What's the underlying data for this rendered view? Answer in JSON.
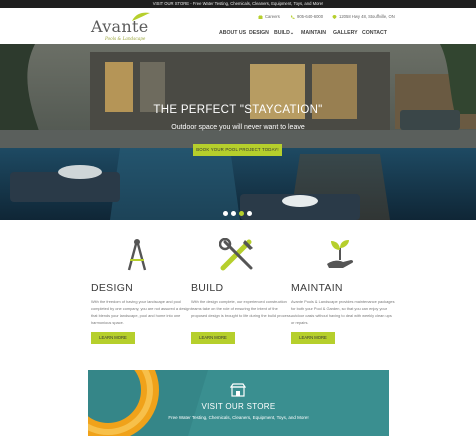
{
  "topbar": {
    "text": "VISIT OUR STORE - Free Water Testing, Chemicals, Cleaners, Equipment, Toys, and More!"
  },
  "brand": {
    "name": "Avante",
    "tagline": "Pools & Landscape"
  },
  "header_contact": {
    "careers": "Careers",
    "phone": "905-640-6000",
    "address": "12058 Hwy 48, Stouffville, ON"
  },
  "nav": {
    "items": [
      {
        "label": "ABOUT US"
      },
      {
        "label": "DESIGN"
      },
      {
        "label": "BUILD"
      },
      {
        "label": "MAINTAIN"
      },
      {
        "label": "GALLERY"
      },
      {
        "label": "CONTACT"
      }
    ]
  },
  "hero": {
    "title": "THE PERFECT \"STAYCATION\"",
    "subtitle": "Outdoor space you will never want to leave",
    "cta": "BOOK YOUR POOL PROJECT TODAY!",
    "slides": 4,
    "active_slide": 3
  },
  "features": [
    {
      "title": "DESIGN",
      "text": "With the freedom of having your landscape and pool completed by one company, you are not assured a design that blends your landscape, pool and home into one harmonious space.",
      "button": "LEARN MORE",
      "icon": "compass-icon"
    },
    {
      "title": "BUILD",
      "text": "With the design complete, our experienced construction teams take on the role of ensuring the intent of the proposed design is brought to life during the build process.",
      "button": "LEARN MORE",
      "icon": "tools-icon"
    },
    {
      "title": "MAINTAIN",
      "text": "Avante Pools & Landscape provides maintenance packages for both your Pool & Garden, so that you can enjoy your outdoor oasis without having to deal with weekly clean ups or repairs.",
      "button": "LEARN MORE",
      "icon": "plant-hand-icon"
    }
  ],
  "store": {
    "title": "VISIT OUR STORE",
    "text": "Free Water Testing, Chemicals, Cleaners, Equipment, Toys, and More!"
  },
  "colors": {
    "accent": "#b6cf2c",
    "topbar": "#1f1f1f",
    "store_bg": "#3a8f90"
  }
}
